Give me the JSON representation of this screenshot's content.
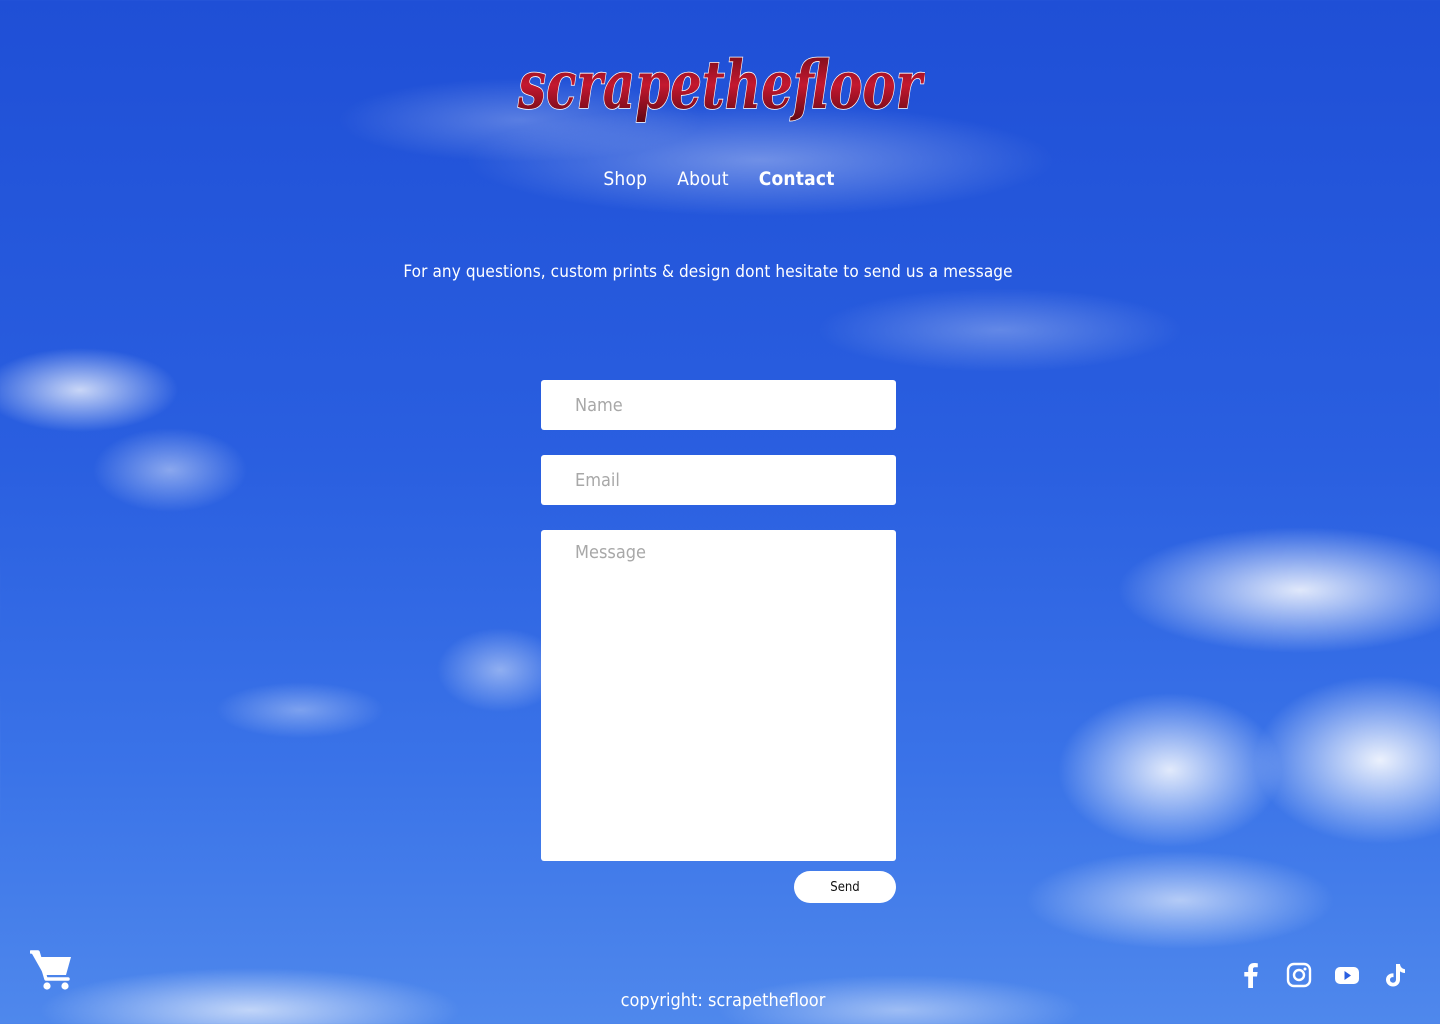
{
  "brand": {
    "logo_text": "scrapethefloor",
    "logo_fill": "#a8142a",
    "logo_outline": "#ffffff"
  },
  "nav": {
    "items": [
      {
        "label": "Shop",
        "active": false
      },
      {
        "label": "About",
        "active": false
      },
      {
        "label": "Contact",
        "active": true
      }
    ]
  },
  "intro": {
    "text": "For any questions, custom prints & design dont hesitate to send us a message"
  },
  "form": {
    "name_placeholder": "Name",
    "email_placeholder": "Email",
    "message_placeholder": "Message",
    "send_label": "Send"
  },
  "footer": {
    "copyright": "copyright: scrapethefloor",
    "cart_icon": "shopping-cart-icon",
    "social_icons": [
      "facebook-icon",
      "instagram-icon",
      "youtube-icon",
      "tiktok-icon"
    ]
  }
}
